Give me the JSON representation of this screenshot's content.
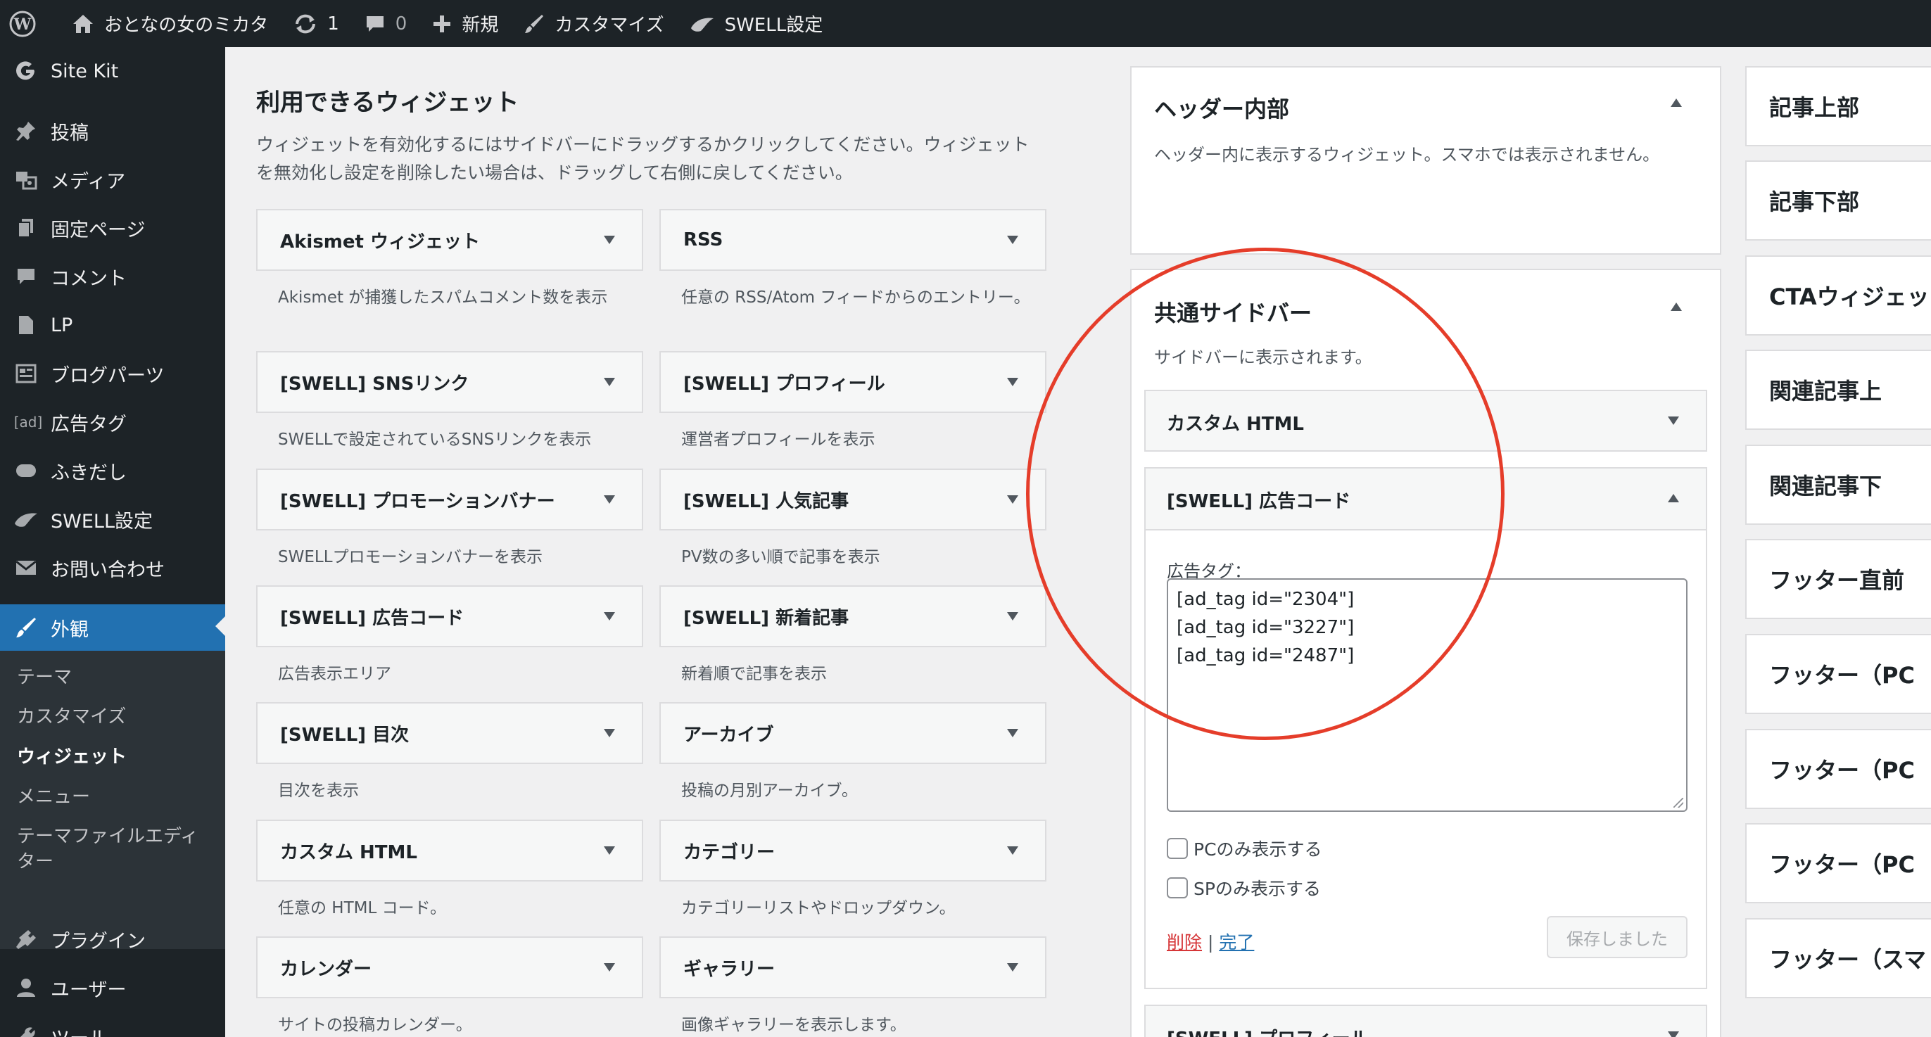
{
  "admin_bar": {
    "site_name": "おとなの女のミカタ",
    "updates": "1",
    "comments": "0",
    "new": "新規",
    "customize": "カスタマイズ",
    "swell": "SWELL設定",
    "icons": [
      "wordpress-icon",
      "home-icon",
      "refresh-icon",
      "comment-icon",
      "plus-icon",
      "brush-icon",
      "swell-icon"
    ]
  },
  "sidebar": {
    "items": [
      {
        "label": "Site Kit",
        "icon": "google-icon"
      },
      {
        "label": "投稿",
        "icon": "pin-icon"
      },
      {
        "label": "メディア",
        "icon": "media-icon"
      },
      {
        "label": "固定ページ",
        "icon": "page-icon"
      },
      {
        "label": "コメント",
        "icon": "comment-icon"
      },
      {
        "label": "LP",
        "icon": "document-icon"
      },
      {
        "label": "ブログパーツ",
        "icon": "grid-icon"
      },
      {
        "label": "広告タグ",
        "icon_text": "[ad]"
      },
      {
        "label": "ふきだし",
        "icon": "bubble-icon"
      },
      {
        "label": "SWELL設定",
        "icon": "swell-icon"
      },
      {
        "label": "お問い合わせ",
        "icon": "mail-icon"
      },
      {
        "label": "外観",
        "icon": "appearance-icon"
      },
      {
        "label": "プラグイン",
        "icon": "plugin-icon"
      },
      {
        "label": "ユーザー",
        "icon": "user-icon"
      },
      {
        "label": "ツール",
        "icon": "wrench-icon"
      }
    ],
    "submenu": [
      "テーマ",
      "カスタマイズ",
      "ウィジェット",
      "メニュー",
      "テーマファイルエディ",
      "ター"
    ]
  },
  "available": {
    "title": "利用できるウィジェット",
    "description": "ウィジェットを有効化するにはサイドバーにドラッグするかクリックしてください。ウィジェットを無効化し設定を削除したい場合は、ドラッグして右側に戻してください。",
    "widgets": [
      {
        "name": "Akismet ウィジェット",
        "desc": "Akismet が捕獲したスパムコメント数を表示"
      },
      {
        "name": "RSS",
        "desc": "任意の RSS/Atom フィードからのエントリー。"
      },
      {
        "name": "[SWELL] SNSリンク",
        "desc": "SWELLで設定されているSNSリンクを表示"
      },
      {
        "name": "[SWELL] プロフィール",
        "desc": "運営者プロフィールを表示"
      },
      {
        "name": "[SWELL] プロモーションバナー",
        "desc": "SWELLプロモーションバナーを表示"
      },
      {
        "name": "[SWELL] 人気記事",
        "desc": "PV数の多い順で記事を表示"
      },
      {
        "name": "[SWELL] 広告コード",
        "desc": "広告表示エリア"
      },
      {
        "name": "[SWELL] 新着記事",
        "desc": "新着順で記事を表示"
      },
      {
        "name": "[SWELL] 目次",
        "desc": "目次を表示"
      },
      {
        "name": "アーカイブ",
        "desc": "投稿の月別アーカイブ。"
      },
      {
        "name": "カスタム HTML",
        "desc": "任意の HTML コード。"
      },
      {
        "name": "カテゴリー",
        "desc": "カテゴリーリストやドロップダウン。"
      },
      {
        "name": "カレンダー",
        "desc": "サイトの投稿カレンダー。"
      },
      {
        "name": "ギャラリー",
        "desc": "画像ギャラリーを表示します。"
      }
    ]
  },
  "areas": {
    "header": {
      "title": "ヘッダー内部",
      "desc": "ヘッダー内に表示するウィジェット。スマホでは表示されません。"
    },
    "sidebar": {
      "title": "共通サイドバー",
      "desc": "サイドバーに表示されます。",
      "custom_html": "カスタム HTML",
      "ad_widget": {
        "title": "[SWELL] 広告コード",
        "label": "広告タグ：",
        "lines": [
          "[ad_tag id=\"2304\"]",
          "[ad_tag id=\"3227\"]",
          "[ad_tag id=\"2487\"]"
        ],
        "pc_only": "PCのみ表示する",
        "sp_only": "SPのみ表示する",
        "delete": "削除",
        "separator": "|",
        "done": "完了",
        "saved": "保存しました"
      },
      "profile": "[SWELL] プロフィール"
    }
  },
  "right_areas": [
    "記事上部",
    "記事下部",
    "CTAウィジェッ",
    "関連記事上",
    "関連記事下",
    "フッター直前",
    "フッター（PC",
    "フッター（PC",
    "フッター（PC",
    "フッター（スマ"
  ],
  "colors": {
    "accent": "#2271b1",
    "annotation": "#e53d2a",
    "dark": "#1d2327"
  }
}
